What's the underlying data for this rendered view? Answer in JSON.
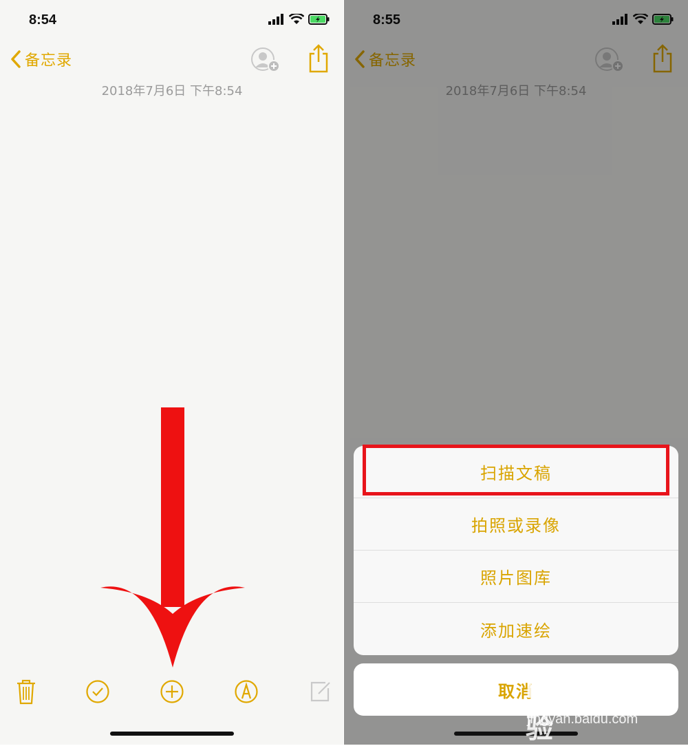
{
  "left": {
    "status": {
      "time": "8:54"
    },
    "nav": {
      "back_label": "备忘录"
    },
    "note": {
      "date": "2018年7月6日 下午8:54"
    }
  },
  "right": {
    "status": {
      "time": "8:55"
    },
    "nav": {
      "back_label": "备忘录"
    },
    "note": {
      "date": "2018年7月6日 下午8:54"
    },
    "action_sheet": {
      "items": [
        "扫描文稿",
        "拍照或录像",
        "照片图库",
        "添加速绘"
      ],
      "cancel_label": "取消"
    }
  },
  "watermark": {
    "brand": "Bai du 经验",
    "url": "jingyan.baidu.com"
  },
  "colors": {
    "accent": "#e0a800",
    "highlight": "#e8141b",
    "arrow": "#ee1111"
  }
}
